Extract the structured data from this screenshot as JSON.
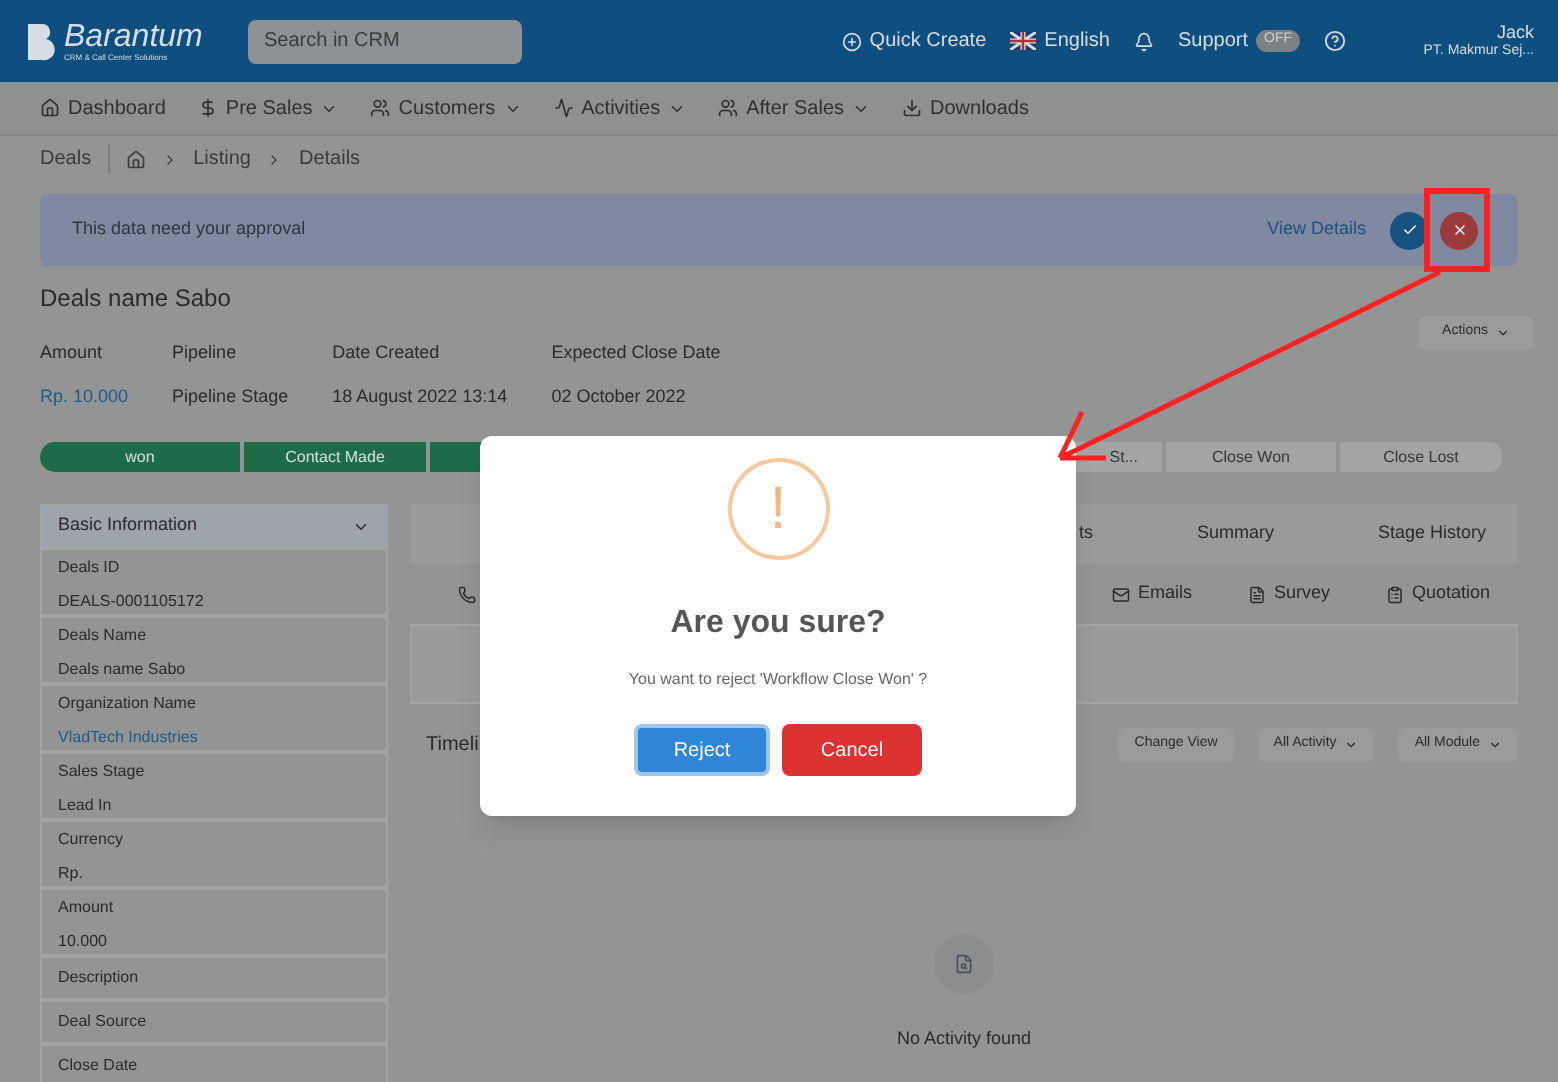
{
  "header": {
    "logo_name": "Barantum",
    "logo_tagline": "CRM & Call Center Solutions",
    "search": {
      "placeholder": "Search in CRM"
    },
    "quick_create": "Quick Create",
    "language": "English",
    "support": {
      "label": "Support",
      "toggle": "OFF",
      "on": false
    },
    "user": {
      "name": "Jack",
      "company": "PT. Makmur Sej..."
    }
  },
  "nav": [
    {
      "label": "Dashboard",
      "dropdown": false
    },
    {
      "label": "Pre Sales",
      "dropdown": true
    },
    {
      "label": "Customers",
      "dropdown": true
    },
    {
      "label": "Activities",
      "dropdown": true
    },
    {
      "label": "After Sales",
      "dropdown": true
    },
    {
      "label": "Downloads",
      "dropdown": false
    }
  ],
  "breadcrumb": {
    "title": "Deals",
    "items": [
      "Listing",
      "Details"
    ]
  },
  "approval": {
    "message": "This data need your approval",
    "link": "View Details"
  },
  "deal": {
    "title": "Deals name Sabo",
    "actions": "Actions",
    "fields": [
      {
        "label": "Amount",
        "value": "Rp. 10.000",
        "link": true
      },
      {
        "label": "Pipeline",
        "value": "Pipeline Stage",
        "link": false
      },
      {
        "label": "Date Created",
        "value": "18 August 2022 13:14",
        "link": false
      },
      {
        "label": "Expected Close Date",
        "value": "02 October 2022",
        "link": false
      }
    ]
  },
  "stages": [
    {
      "label": "won",
      "done": true
    },
    {
      "label": "Contact Made",
      "done": true
    },
    {
      "done": true
    },
    {
      "label": "St...",
      "done": false
    },
    {
      "label": "Close Won",
      "done": false
    },
    {
      "label": "Close Lost",
      "done": false
    }
  ],
  "basic_info": {
    "title": "Basic Information",
    "expanded": true,
    "fields": [
      {
        "label": "Deals ID",
        "value": "DEALS-0001105172",
        "link": false
      },
      {
        "label": "Deals Name",
        "value": "Deals name Sabo",
        "link": false
      },
      {
        "label": "Organization Name",
        "value": "VladTech Industries",
        "link": true
      },
      {
        "label": "Sales Stage",
        "value": "Lead In",
        "link": false
      },
      {
        "label": "Currency",
        "value": "Rp.",
        "link": false
      },
      {
        "label": "Amount",
        "value": "10.000",
        "link": false
      },
      {
        "label": "Description"
      },
      {
        "label": "Deal Source"
      },
      {
        "label": "Close Date"
      }
    ]
  },
  "detail_tabs": [
    "ts",
    "Summary",
    "Stage History"
  ],
  "activity_tabs": [
    {
      "label": "Emails"
    },
    {
      "label": "Survey"
    },
    {
      "label": "Quotation"
    }
  ],
  "timeline": {
    "title": "Timeli",
    "buttons": [
      {
        "label": "Change View",
        "dropdown": false
      },
      {
        "label": "All Activity",
        "dropdown": true
      },
      {
        "label": "All Module",
        "dropdown": true
      }
    ]
  },
  "empty": {
    "message": "No Activity found"
  },
  "dialog": {
    "icon": "!",
    "title": "Are you sure?",
    "message": "You want to reject 'Workflow Close Won' ?",
    "confirm": "Reject",
    "cancel": "Cancel"
  }
}
